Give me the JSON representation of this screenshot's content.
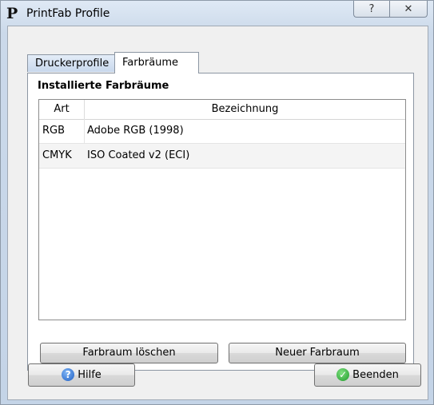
{
  "window": {
    "title": "PrintFab Profile",
    "app_icon_letter": "P",
    "caption_buttons": {
      "help": "?",
      "close": "✕"
    }
  },
  "tabs": [
    {
      "label": "Druckerprofile",
      "active": false
    },
    {
      "label": "Farbräume",
      "active": true
    }
  ],
  "panel": {
    "group_title": "Installierte Farbräume",
    "table": {
      "headers": {
        "art": "Art",
        "bezeichnung": "Bezeichnung"
      },
      "rows": [
        {
          "art": "RGB",
          "bezeichnung": "Adobe RGB (1998)"
        },
        {
          "art": "CMYK",
          "bezeichnung": "ISO Coated v2 (ECI)"
        }
      ]
    },
    "buttons": {
      "delete": "Farbraum löschen",
      "new": "Neuer Farbraum"
    }
  },
  "footer": {
    "help": {
      "label": "Hilfe",
      "icon": "help-icon"
    },
    "quit": {
      "label": "Beenden",
      "icon": "check-icon"
    }
  },
  "colors": {
    "frame": "#c4d4e7",
    "client_bg": "#f0f0f0",
    "help_icon": "#1f5fc4",
    "check_icon": "#1e9a2a"
  }
}
